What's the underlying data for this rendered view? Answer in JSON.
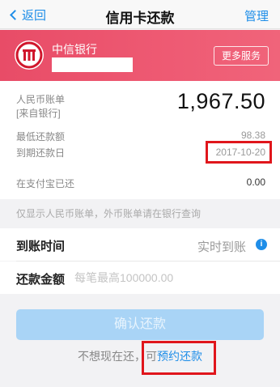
{
  "nav": {
    "back_label": "返回",
    "title": "信用卡还款",
    "manage_label": "管理"
  },
  "bank": {
    "name": "中信银行",
    "more_services_label": "更多服务"
  },
  "bill": {
    "rmb_bill_label_1": "人民币账单",
    "rmb_bill_label_2": "[来自银行]",
    "amount": "1,967.50",
    "min_payment_label": "最低还款额",
    "min_payment_value": "98.38",
    "due_date_label": "到期还款日",
    "due_date_value": "2017-10-20",
    "paid_label": "在支付宝已还",
    "paid_value": "0.00"
  },
  "notice": "仅显示人民币账单，外币账单请在银行查询",
  "arrival": {
    "label": "到账时间",
    "value": "实时到账",
    "info_icon": "i"
  },
  "repay_amount": {
    "label": "还款金额",
    "placeholder": "每笔最高100000.00"
  },
  "confirm_label": "确认还款",
  "footer": {
    "prefix": "不想现在还，可",
    "link": "预约还款"
  },
  "colors": {
    "accent": "#1f8ee8",
    "bank_header": "#ee5a73",
    "highlight": "#e0161c",
    "button_disabled": "#a9d4f6"
  }
}
